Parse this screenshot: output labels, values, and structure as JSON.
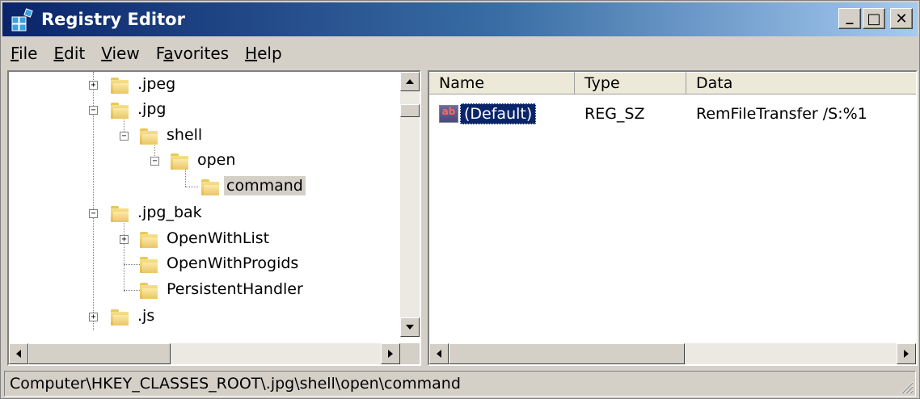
{
  "window": {
    "title": "Registry Editor",
    "buttons": {
      "minimize": "_",
      "maximize": "□",
      "close": "✕"
    }
  },
  "menu": [
    {
      "label": "File",
      "mnemonic": "F",
      "rest": "ile"
    },
    {
      "label": "Edit",
      "mnemonic": "E",
      "rest": "dit"
    },
    {
      "label": "View",
      "mnemonic": "V",
      "rest": "iew"
    },
    {
      "label": "Favorites",
      "pre": "F",
      "mnemonic": "a",
      "rest": "vorites"
    },
    {
      "label": "Help",
      "mnemonic": "H",
      "rest": "elp"
    }
  ],
  "tree": {
    "items": [
      {
        "label": ".jpeg",
        "expander": "+"
      },
      {
        "label": ".jpg",
        "expander": "−"
      },
      {
        "label": "shell",
        "expander": "−"
      },
      {
        "label": "open",
        "expander": "−"
      },
      {
        "label": "command",
        "selected": true
      },
      {
        "label": ".jpg_bak",
        "expander": "−"
      },
      {
        "label": "OpenWithList",
        "expander": "+"
      },
      {
        "label": "OpenWithProgids"
      },
      {
        "label": "PersistentHandler"
      },
      {
        "label": ".js",
        "expander": "+"
      }
    ]
  },
  "list": {
    "columns": [
      "Name",
      "Type",
      "Data"
    ],
    "rows": [
      {
        "icon": "ab",
        "name": "(Default)",
        "type": "REG_SZ",
        "data": "RemFileTransfer /S:%1"
      }
    ]
  },
  "status": {
    "path": "Computer\\HKEY_CLASSES_ROOT\\.jpg\\shell\\open\\command"
  }
}
